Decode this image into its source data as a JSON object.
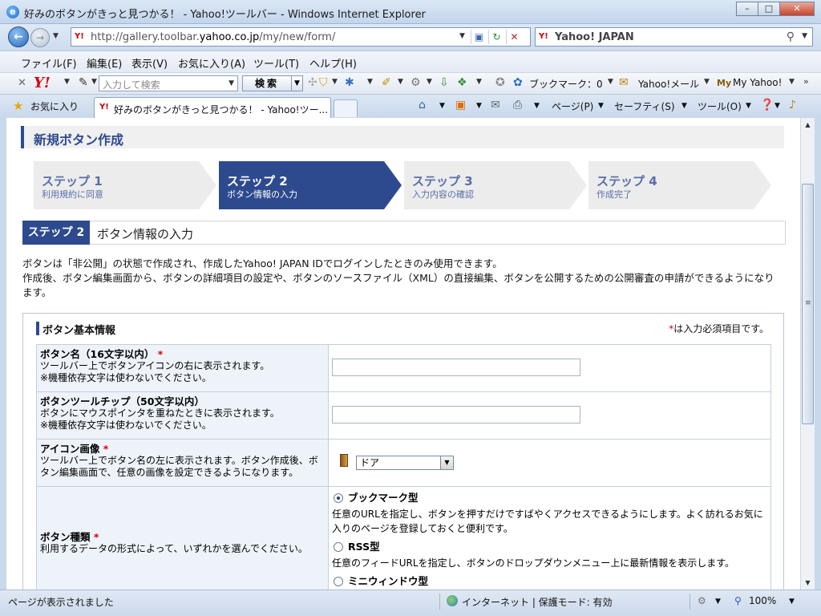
{
  "window": {
    "title": "好みのボタンがきっと見つかる！ - Yahoo!ツールバー - Windows Internet Explorer",
    "btn_min": "–",
    "btn_max": "□",
    "btn_close": "✕"
  },
  "nav": {
    "url_prefix": "http://gallery.toolbar.",
    "url_domain": "yahoo.co.jp",
    "url_path": "/my/new/form/",
    "search_label": "Yahoo! JAPAN"
  },
  "menu": {
    "items": [
      "ファイル(F)",
      "編集(E)",
      "表示(V)",
      "お気に入り(A)",
      "ツール(T)",
      "ヘルプ(H)"
    ]
  },
  "ytoolbar": {
    "logo": "Y!",
    "search_placeholder": "入力して検索",
    "search_button": "検索",
    "bookmark": "ブックマーク：0",
    "mail": "Yahoo!メール",
    "my": "My Yahoo!"
  },
  "tabs": {
    "favorites": "お気に入り",
    "active_tab": "好みのボタンがきっと見つかる！ - Yahoo!ツー...",
    "page": "ページ(P)",
    "safety": "セーフティ(S)",
    "tools": "ツール(O)"
  },
  "content": {
    "section_title": "新規ボタン作成",
    "steps": [
      {
        "name": "ステップ 1",
        "desc": "利用規約に同意"
      },
      {
        "name": "ステップ 2",
        "desc": "ボタン情報の入力"
      },
      {
        "name": "ステップ 3",
        "desc": "入力内容の確認"
      },
      {
        "name": "ステップ 4",
        "desc": "作成完了"
      }
    ],
    "sub_badge": "ステップ 2",
    "sub_title": "ボタン情報の入力",
    "intro_line1": "ボタンは「非公開」の状態で作成され、作成したYahoo! JAPAN IDでログインしたときのみ使用できます。",
    "intro_line2": "作成後、ボタン編集画面から、ボタンの詳細項目の設定や、ボタンのソースファイル（XML）の直接編集、ボタンを公開するための公開審査の申請ができるようになります。",
    "form_heading": "ボタン基本情報",
    "required_note": "は入力必須項目です。",
    "required_mark": "*",
    "fields": {
      "name_label": "ボタン名（16文字以内）",
      "name_help1": "ツールバー上でボタンアイコンの右に表示されます。",
      "name_help2": "※機種依存文字は使わないでください。",
      "tooltip_label": "ボタンツールチップ（50文字以内）",
      "tooltip_help1": "ボタンにマウスポインタを重ねたときに表示されます。",
      "tooltip_help2": "※機種依存文字は使わないでください。",
      "icon_label": "アイコン画像",
      "icon_help": "ツールバー上でボタン名の左に表示されます。ボタン作成後、ボタン編集画面で、任意の画像を設定できるようになります。",
      "icon_selected": "ドア",
      "type_label": "ボタン種類",
      "type_help": "利用するデータの形式によって、いずれかを選んでください。",
      "type_options": [
        {
          "name": "ブックマーク型",
          "desc": "任意のURLを指定し、ボタンを押すだけですばやくアクセスできるようにします。よく訪れるお気に入りのページを登録しておくと便利です。"
        },
        {
          "name": "RSS型",
          "desc": "任意のフィードURLを指定し、ボタンのドロップダウンメニュー上に最新情報を表示します。"
        },
        {
          "name": "ミニウィンドウ型",
          "desc": ""
        }
      ]
    }
  },
  "status": {
    "left": "ページが表示されました",
    "zone": "インターネット | 保護モード: 有効",
    "zoom": "100%"
  },
  "colors": {
    "accent": "#2e4a8e",
    "required": "#dd0000"
  }
}
